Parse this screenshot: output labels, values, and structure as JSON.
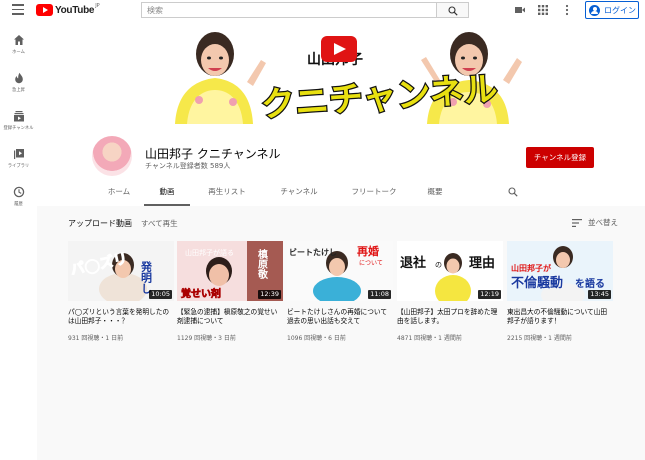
{
  "topbar": {
    "logo_text": "YouTube",
    "logo_region": "JP",
    "search_placeholder": "検索",
    "login_label": "ログイン"
  },
  "sidebar": {
    "items": [
      {
        "label": "ホーム",
        "icon": "home-icon"
      },
      {
        "label": "急上昇",
        "icon": "trending-icon"
      },
      {
        "label": "登録チャンネル",
        "icon": "subscriptions-icon"
      },
      {
        "label": "ライブラリ",
        "icon": "library-icon"
      },
      {
        "label": "履歴",
        "icon": "history-icon"
      }
    ]
  },
  "banner": {
    "name_text": "山田邦子",
    "channel_text": "クニチャンネル"
  },
  "channel": {
    "name": "山田邦子 クニチャンネル",
    "subscribers": "チャンネル登録者数 589人",
    "subscribe_label": "チャンネル登録"
  },
  "tabs": [
    {
      "label": "ホーム",
      "active": false
    },
    {
      "label": "動画",
      "active": true
    },
    {
      "label": "再生リスト",
      "active": false
    },
    {
      "label": "チャンネル",
      "active": false
    },
    {
      "label": "フリートーク",
      "active": false
    },
    {
      "label": "概要",
      "active": false
    }
  ],
  "uploads": {
    "title": "アップロード動画",
    "play_all": "すべて再生",
    "sort_label": "並べ替え",
    "videos": [
      {
        "thumb_text": [
          "パ◯ズリ",
          "発明し"
        ],
        "duration": "10:05",
        "title": "パ◯ズリという言葉を発明したのは山田邦子・・・？",
        "meta": "931 回視聴・1 日前"
      },
      {
        "thumb_text": [
          "山田邦子が語る",
          "槙原敬",
          "覚せい剤"
        ],
        "duration": "12:39",
        "title": "【緊急の逮捕】槇原敬之の覚せい剤逮捕について",
        "meta": "1129 回視聴・3 日前"
      },
      {
        "thumb_text": [
          "ビートたけし",
          "再婚",
          "について"
        ],
        "duration": "11:08",
        "title": "ビートたけしさんの再婚について 過去の思い出話も交えて",
        "meta": "1096 回視聴・6 日前"
      },
      {
        "thumb_text": [
          "退社",
          "の",
          "理由"
        ],
        "duration": "12:19",
        "title": "【山田邦子】太田プロを辞めた理由を話します。",
        "meta": "4871 回視聴・1 週間前"
      },
      {
        "thumb_text": [
          "山田邦子が",
          "不倫騒動",
          "を語る"
        ],
        "duration": "13:45",
        "title": "東出昌大の不倫騒動について山田邦子が語ります！",
        "meta": "2215 回視聴・1 週間前"
      }
    ]
  }
}
